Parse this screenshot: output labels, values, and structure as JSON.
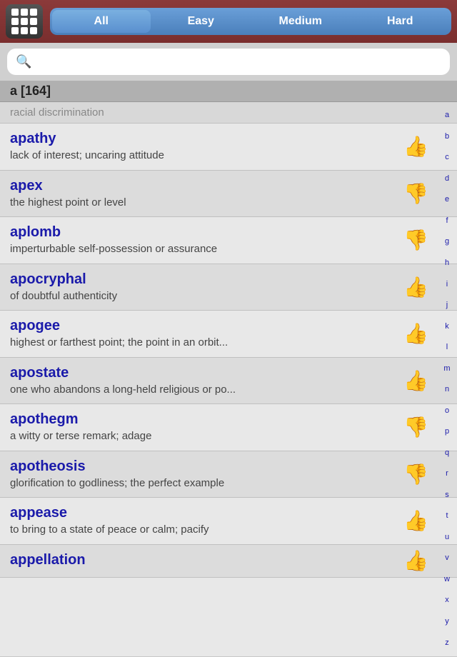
{
  "header": {
    "tabs": [
      {
        "label": "All",
        "active": true
      },
      {
        "label": "Easy",
        "active": false
      },
      {
        "label": "Medium",
        "active": false
      },
      {
        "label": "Hard",
        "active": false
      }
    ]
  },
  "search": {
    "placeholder": "",
    "value": ""
  },
  "section": {
    "label": "a [164]"
  },
  "partial_top": {
    "text": "racial discrimination"
  },
  "words": [
    {
      "term": "apathy",
      "definition": "lack of interest; uncaring attitude",
      "thumb": "👍",
      "thumb_up": true
    },
    {
      "term": "apex",
      "definition": "the highest point or level",
      "thumb": "👎",
      "thumb_up": false
    },
    {
      "term": "aplomb",
      "definition": "imperturbable self-possession or assurance",
      "thumb": "👎",
      "thumb_up": false
    },
    {
      "term": "apocryphal",
      "definition": "of doubtful authenticity",
      "thumb": "👍",
      "thumb_up": true
    },
    {
      "term": "apogee",
      "definition": "highest or farthest point; the point in an orbit...",
      "thumb": "👍",
      "thumb_up": true
    },
    {
      "term": "apostate",
      "definition": "one who abandons a long-held religious or po...",
      "thumb": "👍",
      "thumb_up": true
    },
    {
      "term": "apothegm",
      "definition": "a witty or terse remark; adage",
      "thumb": "👎",
      "thumb_up": false
    },
    {
      "term": "apotheosis",
      "definition": "glorification to godliness; the perfect example",
      "thumb": "👎",
      "thumb_up": false
    },
    {
      "term": "appease",
      "definition": "to bring to a state of peace or calm; pacify",
      "thumb": "👍",
      "thumb_up": true
    },
    {
      "term": "appellation",
      "definition": "",
      "thumb": "👍",
      "thumb_up": true
    }
  ],
  "alphabet": [
    "a",
    "b",
    "c",
    "d",
    "e",
    "f",
    "g",
    "h",
    "i",
    "j",
    "k",
    "l",
    "m",
    "n",
    "o",
    "p",
    "q",
    "r",
    "s",
    "t",
    "u",
    "v",
    "w",
    "x",
    "y",
    "z"
  ]
}
